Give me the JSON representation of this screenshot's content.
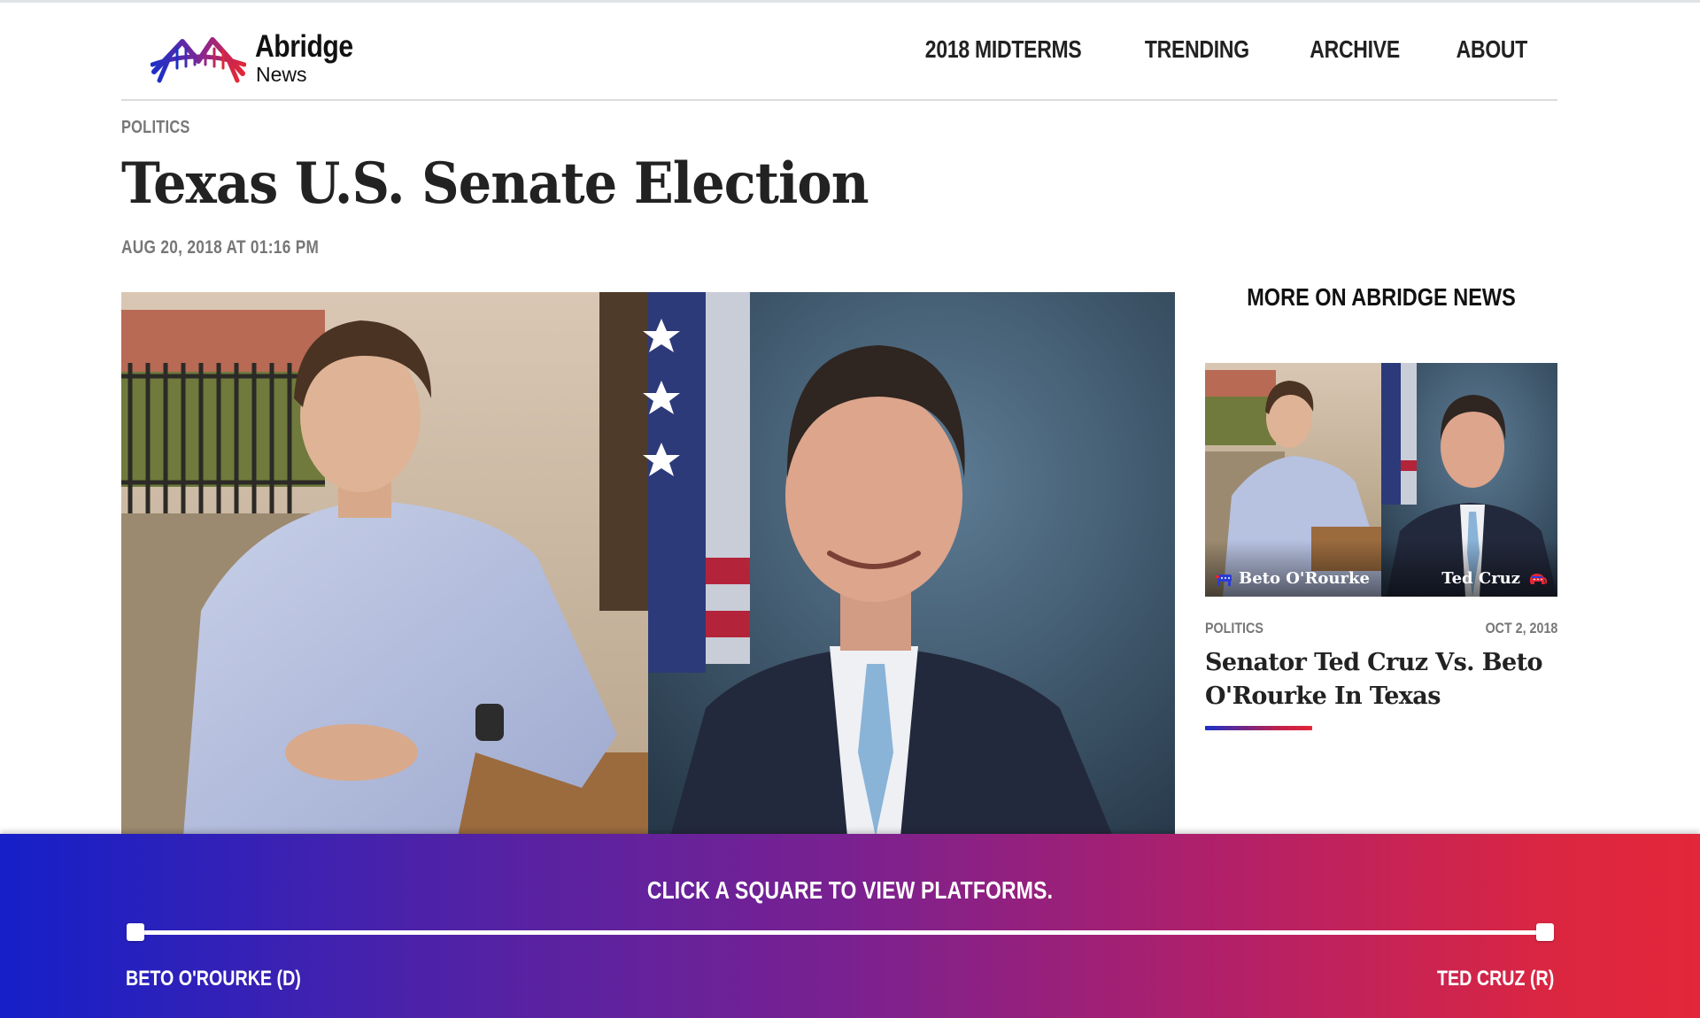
{
  "site": {
    "logo_title": "Abridge",
    "logo_subtitle": "News",
    "brand_blue": "#1c2fc6",
    "brand_red": "#e32737"
  },
  "nav": {
    "items": [
      "2018 MIDTERMS",
      "TRENDING",
      "ARCHIVE",
      "ABOUT"
    ]
  },
  "article": {
    "category": "POLITICS",
    "title": "Texas U.S. Senate Election",
    "dateline": "AUG 20, 2018 AT 01:16 PM"
  },
  "sidebar": {
    "heading": "MORE ON ABRIDGE NEWS",
    "card": {
      "left_caption": "Beto O'Rourke",
      "right_caption": "Ted Cruz",
      "left_icon": "democrat-donkey-icon",
      "right_icon": "republican-elephant-icon",
      "category": "POLITICS",
      "date": "OCT 2, 2018",
      "title": "Senator Ted Cruz Vs. Beto O'Rourke In Texas"
    }
  },
  "platform_bar": {
    "instruction": "CLICK A SQUARE TO VIEW PLATFORMS.",
    "left_label": "BETO O'ROURKE (D)",
    "right_label": "TED CRUZ (R)",
    "gradient_start": "#1520c8",
    "gradient_end": "#e3263a"
  }
}
